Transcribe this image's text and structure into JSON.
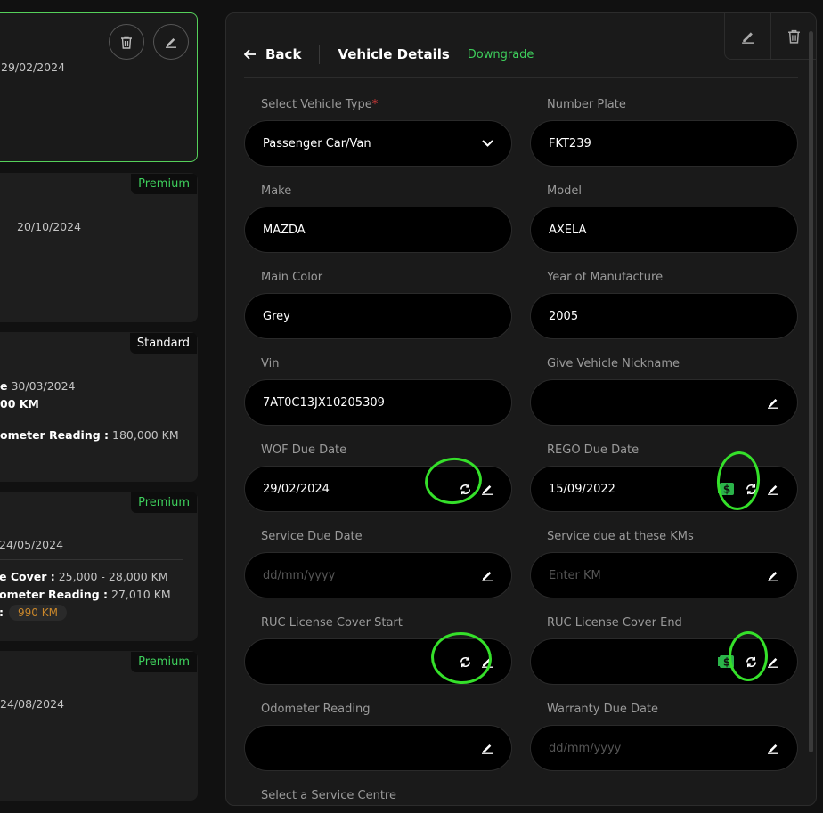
{
  "cards": [
    {
      "date": "29/02/2024"
    },
    {
      "tag": "Premium",
      "date": "20/10/2024"
    },
    {
      "tag": "Standard",
      "date_prefix": "e",
      "date": "30/03/2024",
      "km": "00 KM",
      "odo_label": "ometer Reading :",
      "odo_value": "180,000 KM"
    },
    {
      "tag": "Premium",
      "date": "24/05/2024",
      "cover_label": "e Cover :",
      "cover_value": "25,000 - 28,000 KM",
      "odo_label": "ometer Reading :",
      "odo_value": "27,010 KM",
      "remaining_label": ":",
      "remaining_value": "990 KM"
    },
    {
      "tag": "Premium",
      "date": "24/08/2024"
    }
  ],
  "panel": {
    "back_label": "Back",
    "title": "Vehicle Details",
    "downgrade_label": "Downgrade"
  },
  "fields": {
    "vehicle_type": {
      "label": "Select Vehicle Type",
      "required": "*",
      "value": "Passenger Car/Van"
    },
    "number_plate": {
      "label": "Number Plate",
      "value": "FKT239"
    },
    "make": {
      "label": "Make",
      "value": "MAZDA"
    },
    "model": {
      "label": "Model",
      "value": "AXELA"
    },
    "main_color": {
      "label": "Main Color",
      "value": "Grey"
    },
    "year": {
      "label": "Year of Manufacture",
      "value": "2005"
    },
    "vin": {
      "label": "Vin",
      "value": "7AT0C13JX10205309"
    },
    "nickname": {
      "label": "Give Vehicle Nickname",
      "value": ""
    },
    "wof": {
      "label": "WOF Due Date",
      "value": "29/02/2024"
    },
    "rego": {
      "label": "REGO Due Date",
      "value": "15/09/2022"
    },
    "service_date": {
      "label": "Service Due Date",
      "placeholder": "dd/mm/yyyy"
    },
    "service_km": {
      "label": "Service due at these KMs",
      "placeholder": "Enter KM"
    },
    "ruc_start": {
      "label": "RUC License Cover Start",
      "value": ""
    },
    "ruc_end": {
      "label": "RUC License Cover End",
      "value": ""
    },
    "odometer": {
      "label": "Odometer Reading",
      "value": ""
    },
    "warranty": {
      "label": "Warranty Due Date",
      "placeholder": "dd/mm/yyyy"
    },
    "service_centre": {
      "label": "Select a Service Centre"
    }
  },
  "colors": {
    "accent": "#3ecf5c",
    "annotation": "#35e02a",
    "required": "#e23b3b"
  }
}
